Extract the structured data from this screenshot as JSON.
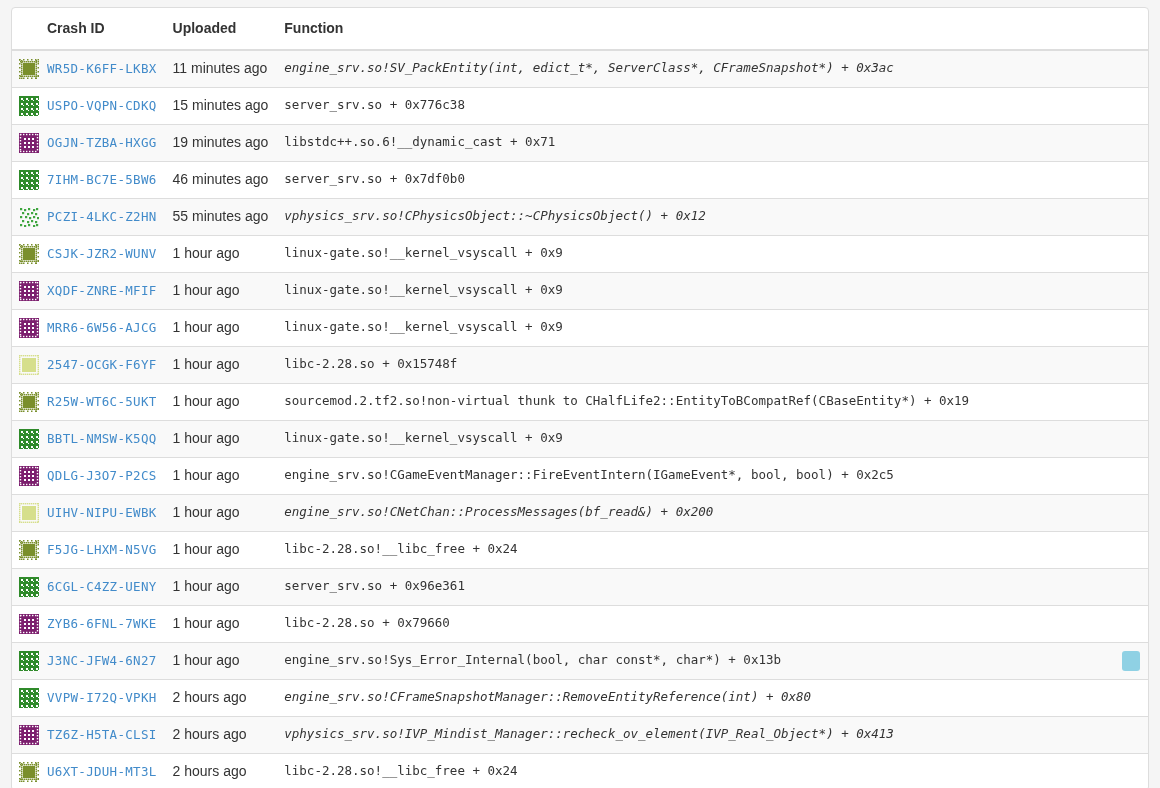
{
  "table": {
    "columns": [
      "Crash ID",
      "Uploaded",
      "Function"
    ],
    "rows": [
      {
        "icon": {
          "kind": "burst",
          "color": "#7a8f2c"
        },
        "crash_id": "WR5D-K6FF-LKBX",
        "uploaded": "11 minutes ago",
        "function": "engine_srv.so!SV_PackEntity(int, edict_t*, ServerClass*, CFrameSnapshot*) + 0x3ac",
        "italic": true,
        "flagged": false
      },
      {
        "icon": {
          "kind": "grid",
          "color": "#2f8a2a"
        },
        "crash_id": "USPO-VQPN-CDKQ",
        "uploaded": "15 minutes ago",
        "function": "server_srv.so + 0x776c38",
        "italic": false,
        "flagged": false
      },
      {
        "icon": {
          "kind": "frame",
          "color": "#7c1f6e"
        },
        "crash_id": "OGJN-TZBA-HXGG",
        "uploaded": "19 minutes ago",
        "function": "libstdc++.so.6!__dynamic_cast + 0x71",
        "italic": false,
        "flagged": false
      },
      {
        "icon": {
          "kind": "grid",
          "color": "#2f8a2a"
        },
        "crash_id": "7IHM-BC7E-5BW6",
        "uploaded": "46 minutes ago",
        "function": "server_srv.so + 0x7df0b0",
        "italic": false,
        "flagged": false
      },
      {
        "icon": {
          "kind": "scatter",
          "color": "#3fa63f"
        },
        "crash_id": "PCZI-4LKC-Z2HN",
        "uploaded": "55 minutes ago",
        "function": "vphysics_srv.so!CPhysicsObject::~CPhysicsObject() + 0x12",
        "italic": true,
        "flagged": false
      },
      {
        "icon": {
          "kind": "burst",
          "color": "#7a8f2c"
        },
        "crash_id": "CSJK-JZR2-WUNV",
        "uploaded": "1 hour ago",
        "function": "linux-gate.so!__kernel_vsyscall + 0x9",
        "italic": false,
        "flagged": false
      },
      {
        "icon": {
          "kind": "frame",
          "color": "#7c1f6e"
        },
        "crash_id": "XQDF-ZNRE-MFIF",
        "uploaded": "1 hour ago",
        "function": "linux-gate.so!__kernel_vsyscall + 0x9",
        "italic": false,
        "flagged": false
      },
      {
        "icon": {
          "kind": "frame",
          "color": "#7c1f6e"
        },
        "crash_id": "MRR6-6W56-AJCG",
        "uploaded": "1 hour ago",
        "function": "linux-gate.so!__kernel_vsyscall + 0x9",
        "italic": false,
        "flagged": false
      },
      {
        "icon": {
          "kind": "block",
          "color": "#d6df8c"
        },
        "crash_id": "2547-OCGK-F6YF",
        "uploaded": "1 hour ago",
        "function": "libc-2.28.so + 0x15748f",
        "italic": false,
        "flagged": false
      },
      {
        "icon": {
          "kind": "burst",
          "color": "#7a8f2c"
        },
        "crash_id": "R25W-WT6C-5UKT",
        "uploaded": "1 hour ago",
        "function": "sourcemod.2.tf2.so!non-virtual thunk to CHalfLife2::EntityToBCompatRef(CBaseEntity*) + 0x19",
        "italic": false,
        "flagged": false
      },
      {
        "icon": {
          "kind": "grid",
          "color": "#2f8a2a"
        },
        "crash_id": "BBTL-NMSW-K5QQ",
        "uploaded": "1 hour ago",
        "function": "linux-gate.so!__kernel_vsyscall + 0x9",
        "italic": false,
        "flagged": false
      },
      {
        "icon": {
          "kind": "frame",
          "color": "#7c1f6e"
        },
        "crash_id": "QDLG-J3O7-P2CS",
        "uploaded": "1 hour ago",
        "function": "engine_srv.so!CGameEventManager::FireEventIntern(IGameEvent*, bool, bool) + 0x2c5",
        "italic": false,
        "flagged": false
      },
      {
        "icon": {
          "kind": "block",
          "color": "#d6df8c"
        },
        "crash_id": "UIHV-NIPU-EWBK",
        "uploaded": "1 hour ago",
        "function": "engine_srv.so!CNetChan::ProcessMessages(bf_read&) + 0x200",
        "italic": true,
        "flagged": false
      },
      {
        "icon": {
          "kind": "burst",
          "color": "#7a8f2c"
        },
        "crash_id": "F5JG-LHXM-N5VG",
        "uploaded": "1 hour ago",
        "function": "libc-2.28.so!__libc_free + 0x24",
        "italic": false,
        "flagged": false
      },
      {
        "icon": {
          "kind": "grid",
          "color": "#2f8a2a"
        },
        "crash_id": "6CGL-C4ZZ-UENY",
        "uploaded": "1 hour ago",
        "function": "server_srv.so + 0x96e361",
        "italic": false,
        "flagged": false
      },
      {
        "icon": {
          "kind": "frame",
          "color": "#7c1f6e"
        },
        "crash_id": "ZYB6-6FNL-7WKE",
        "uploaded": "1 hour ago",
        "function": "libc-2.28.so + 0x79660",
        "italic": false,
        "flagged": false
      },
      {
        "icon": {
          "kind": "grid",
          "color": "#2f8a2a"
        },
        "crash_id": "J3NC-JFW4-6N27",
        "uploaded": "1 hour ago",
        "function": "engine_srv.so!Sys_Error_Internal(bool, char const*, char*) + 0x13b",
        "italic": false,
        "flagged": true
      },
      {
        "icon": {
          "kind": "grid",
          "color": "#2f8a2a"
        },
        "crash_id": "VVPW-I72Q-VPKH",
        "uploaded": "2 hours ago",
        "function": "engine_srv.so!CFrameSnapshotManager::RemoveEntityReference(int) + 0x80",
        "italic": true,
        "flagged": false
      },
      {
        "icon": {
          "kind": "frame",
          "color": "#7c1f6e"
        },
        "crash_id": "TZ6Z-H5TA-CLSI",
        "uploaded": "2 hours ago",
        "function": "vphysics_srv.so!IVP_Mindist_Manager::recheck_ov_element(IVP_Real_Object*) + 0x413",
        "italic": true,
        "flagged": false
      },
      {
        "icon": {
          "kind": "burst",
          "color": "#7a8f2c"
        },
        "crash_id": "U6XT-JDUH-MT3L",
        "uploaded": "2 hours ago",
        "function": "libc-2.28.so!__libc_free + 0x24",
        "italic": false,
        "flagged": false
      }
    ]
  }
}
